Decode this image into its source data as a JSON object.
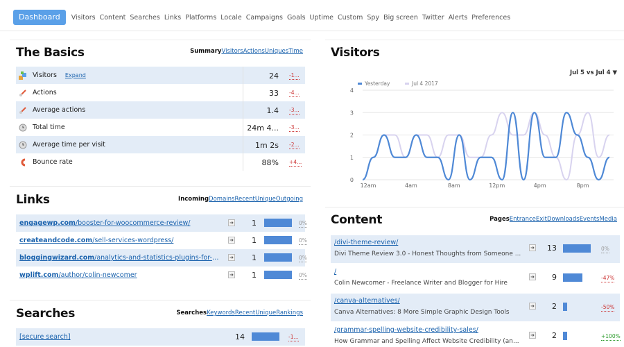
{
  "nav": {
    "active": "Dashboard",
    "items": [
      "Visitors",
      "Content",
      "Searches",
      "Links",
      "Platforms",
      "Locale",
      "Campaigns",
      "Goals",
      "Uptime",
      "Custom",
      "Spy",
      "Big screen",
      "Twitter",
      "Alerts",
      "Preferences"
    ]
  },
  "basics": {
    "title": "The Basics",
    "tabs": {
      "current": "Summary",
      "links": [
        "Visitors",
        "Actions",
        "Uniques",
        "Time"
      ]
    },
    "expand": "Expand",
    "rows": [
      {
        "icon": "visitors-icon",
        "label": "Visitors",
        "value": "24",
        "change": "-1..."
      },
      {
        "icon": "actions-icon",
        "label": "Actions",
        "value": "33",
        "change": "-4..."
      },
      {
        "icon": "average-actions-icon",
        "label": "Average actions",
        "value": "1.4",
        "change": "-3..."
      },
      {
        "icon": "clock-icon",
        "label": "Total time",
        "value": "24m 4...",
        "change": "-3..."
      },
      {
        "icon": "clock-icon",
        "label": "Average time per visit",
        "value": "1m 2s",
        "change": "-2..."
      },
      {
        "icon": "bounce-icon",
        "label": "Bounce rate",
        "value": "88%",
        "change": "+4..."
      }
    ]
  },
  "links": {
    "title": "Links",
    "tabs": {
      "current": "Incoming",
      "links": [
        "Domains",
        "Recent",
        "Unique",
        "Outgoing"
      ]
    },
    "rows": [
      {
        "domain": "engagewp.com",
        "path": "/booster-for-woocommerce-review/",
        "value": "1",
        "change": "0%",
        "bar": 1.0
      },
      {
        "domain": "createandcode.com",
        "path": "/sell-services-wordpress/",
        "value": "1",
        "change": "0%",
        "bar": 1.0
      },
      {
        "domain": "bloggingwizard.com",
        "path": "/analytics-and-statistics-plugins-for-wor...",
        "value": "1",
        "change": "0%",
        "bar": 1.0
      },
      {
        "domain": "wplift.com",
        "path": "/author/colin-newcomer",
        "value": "1",
        "change": "0%",
        "bar": 1.0
      }
    ]
  },
  "searches": {
    "title": "Searches",
    "tabs": {
      "current": "Searches",
      "links": [
        "Keywords",
        "Recent",
        "Unique",
        "Rankings"
      ]
    },
    "rows": [
      {
        "term": "[secure search]",
        "value": "14",
        "change": "-1...",
        "bar": 1.0
      }
    ]
  },
  "visitors_chart": {
    "title": "Visitors",
    "range": "Jul 5 vs Jul 4 ▼"
  },
  "content": {
    "title": "Content",
    "tabs": {
      "current": "Pages",
      "links": [
        "Entrance",
        "Exit",
        "Downloads",
        "Events",
        "Media"
      ]
    },
    "rows": [
      {
        "path": "/divi-theme-review/",
        "desc": "Divi Theme Review 3.0 - Honest Thoughts from Someone ...",
        "value": "13",
        "change": "0%",
        "bar": 1.0,
        "kind": "zero"
      },
      {
        "path": "/",
        "desc": "Colin Newcomer - Freelance Writer and Blogger for Hire",
        "value": "9",
        "change": "-47%",
        "bar": 0.69,
        "kind": "neg"
      },
      {
        "path": "/canva-alternatives/",
        "desc": "Canva Alternatives: 8 More Simple Graphic Design Tools",
        "value": "2",
        "change": "-50%",
        "bar": 0.15,
        "kind": "neg"
      },
      {
        "path": "/grammar-spelling-website-credibility-sales/",
        "desc": "How Grammar and Spelling Affect Website Credibility (an...",
        "value": "2",
        "change": "+100%",
        "bar": 0.15,
        "kind": "up"
      }
    ]
  },
  "chart_data": {
    "type": "line",
    "title": "",
    "xlabel": "",
    "ylabel": "",
    "ylim": [
      0,
      4
    ],
    "x_ticks": [
      "12am",
      "4am",
      "8am",
      "12pm",
      "4pm",
      "8pm"
    ],
    "y_ticks": [
      "0",
      "1",
      "2",
      "3",
      "4"
    ],
    "legend_position": "top-left",
    "series": [
      {
        "name": "Yesterday",
        "color": "#4f89d6",
        "values": [
          0,
          1,
          2,
          1,
          1,
          2,
          1,
          1,
          0,
          2,
          0,
          1,
          1,
          0,
          3,
          0,
          3,
          1,
          1,
          3,
          2,
          1,
          0,
          1
        ]
      },
      {
        "name": "Jul 4 2017",
        "color": "#d8d3ef",
        "values": [
          0,
          1,
          2,
          2,
          1,
          2,
          2,
          1,
          2,
          2,
          1,
          1,
          2,
          3,
          2,
          2,
          3,
          2,
          1,
          0,
          2,
          3,
          1,
          2
        ]
      }
    ]
  }
}
